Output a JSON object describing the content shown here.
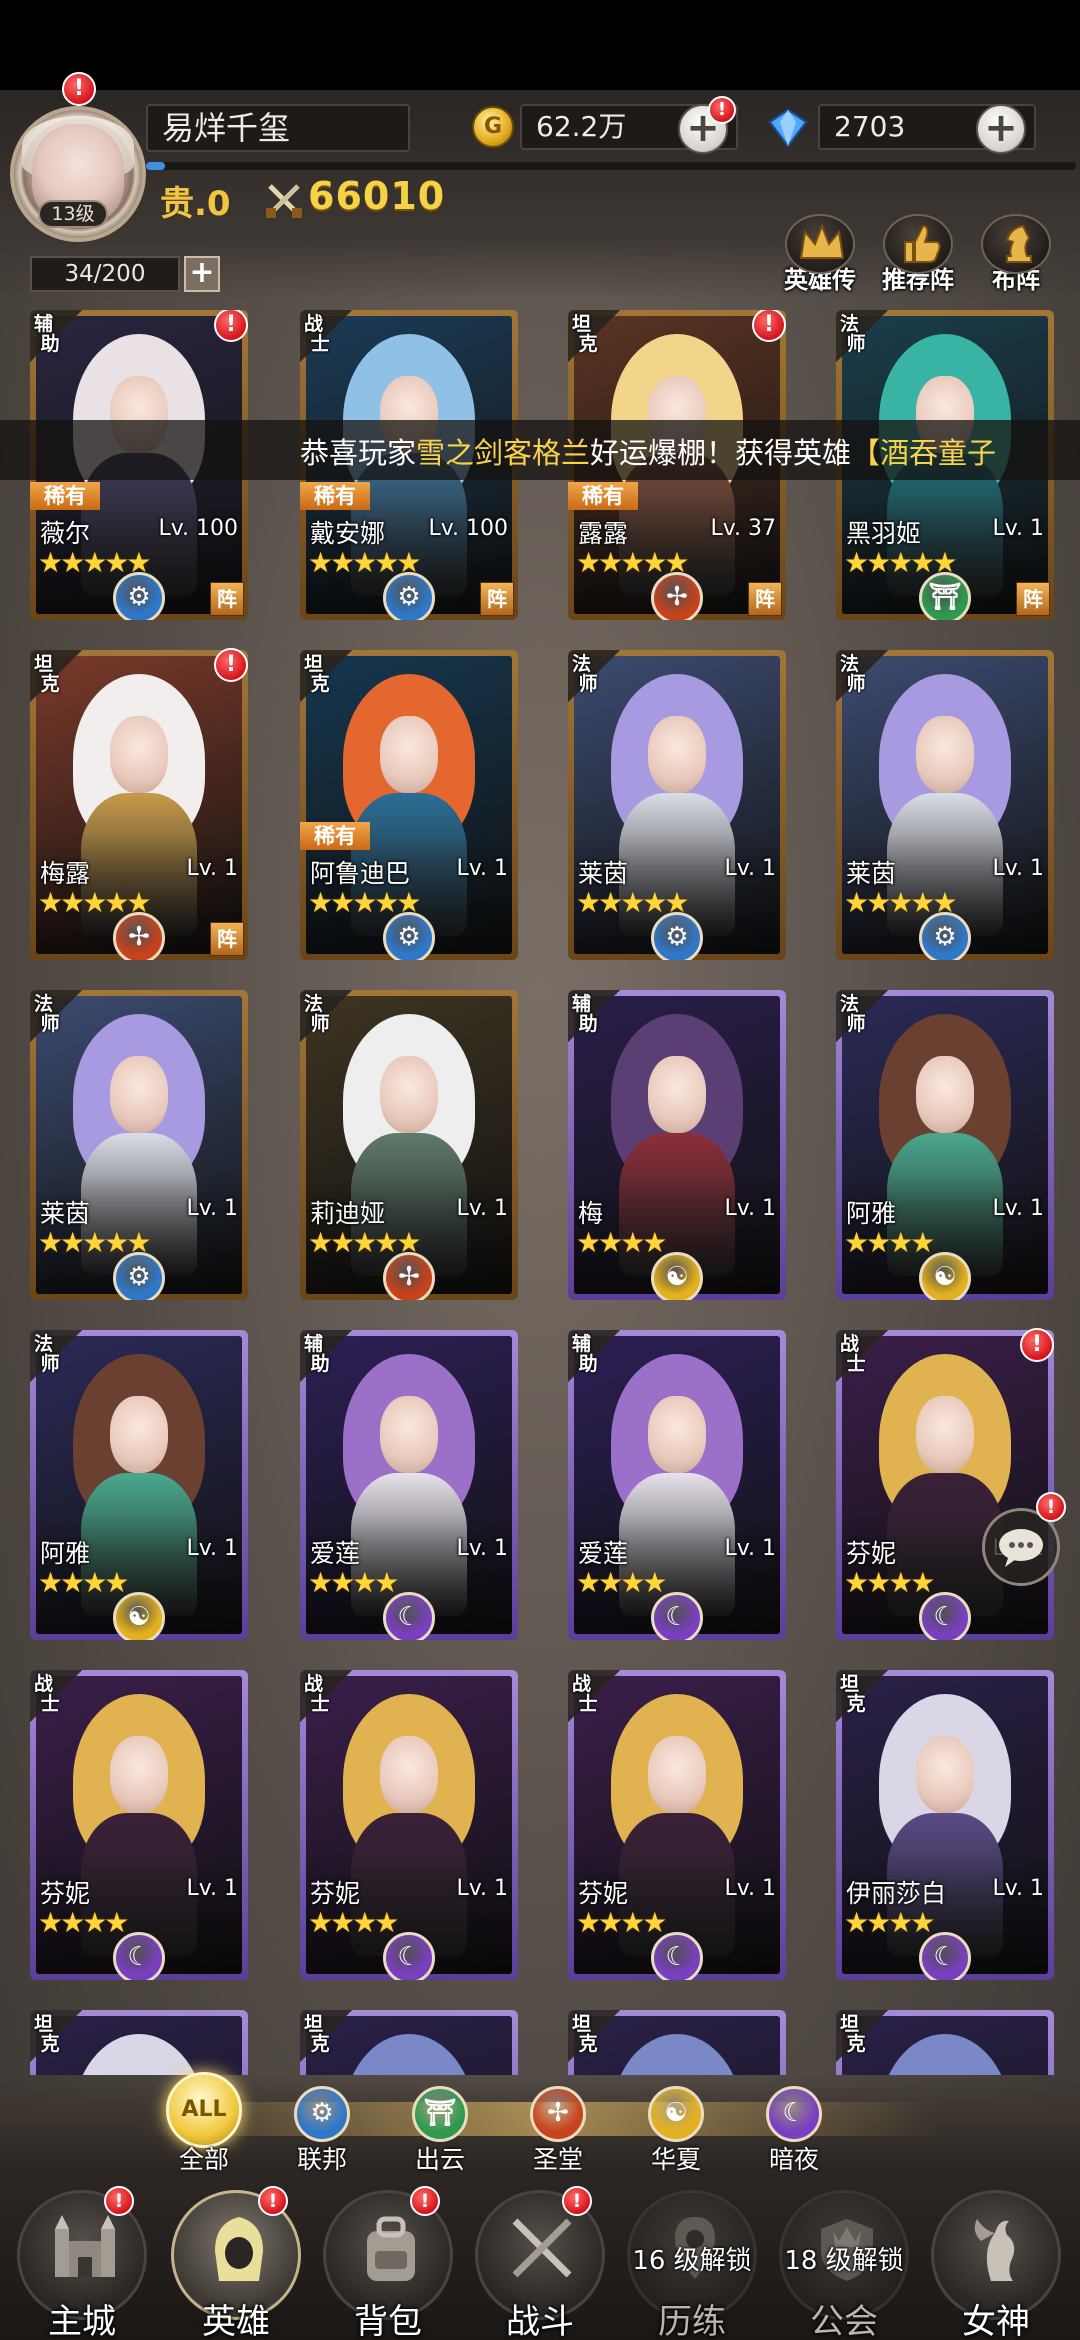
{
  "player": {
    "name": "易烊千玺",
    "level": "13级",
    "vip": "贵.0",
    "power": "66010",
    "gold": "62.2万",
    "gems": "2703",
    "xp_fraction": 0.02
  },
  "roster": {
    "count": "34/200"
  },
  "top_buttons": [
    {
      "label": "英雄传",
      "icon": "crown-icon"
    },
    {
      "label": "推荐阵",
      "icon": "thumbs-up-icon"
    },
    {
      "label": "布阵",
      "icon": "chess-knight-icon"
    }
  ],
  "marquee": {
    "prefix": "恭喜玩家",
    "player": "雪之剑客格兰",
    "middle": "好运爆棚！获得英雄",
    "hero": "【酒吞童子"
  },
  "heroes": [
    {
      "role": "辅助",
      "name": "薇尔",
      "level": "Lv. 100",
      "stars": 5,
      "rare": "稀有",
      "faction": "联邦",
      "formation": "阵",
      "alert": true,
      "frame": "gold",
      "hair": "#e9e1e4",
      "body": "#3c3a58",
      "bg": "#2a2540"
    },
    {
      "role": "战士",
      "name": "戴安娜",
      "level": "Lv. 100",
      "stars": 5,
      "rare": "稀有",
      "faction": "联邦",
      "formation": "阵",
      "alert": false,
      "frame": "gold",
      "hair": "#8fc1e6",
      "body": "#3b6b8f",
      "bg": "#1c3b56"
    },
    {
      "role": "坦克",
      "name": "露露",
      "level": "Lv. 37",
      "stars": 5,
      "rare": "稀有",
      "faction": "圣堂",
      "formation": "阵",
      "alert": true,
      "frame": "gold",
      "hair": "#f2d58a",
      "body": "#7a4b3a",
      "bg": "#5b3423"
    },
    {
      "role": "法师",
      "name": "黑羽姬",
      "level": "Lv. 1",
      "stars": 5,
      "rare": "",
      "faction": "出云",
      "formation": "阵",
      "alert": false,
      "frame": "gold",
      "hair": "#39b3a4",
      "body": "#1f6f7a",
      "bg": "#1b3e4c"
    },
    {
      "role": "坦克",
      "name": "梅露",
      "level": "Lv. 1",
      "stars": 5,
      "rare": "",
      "faction": "圣堂",
      "formation": "阵",
      "alert": true,
      "frame": "gold",
      "hair": "#f2eeee",
      "body": "#c79a4a",
      "bg": "#7a3a2a"
    },
    {
      "role": "坦克",
      "name": "阿鲁迪巴",
      "level": "Lv. 1",
      "stars": 5,
      "rare": "稀有",
      "faction": "联邦",
      "formation": "",
      "alert": false,
      "frame": "gold",
      "hair": "#e4672f",
      "body": "#2b6f97",
      "bg": "#16374f"
    },
    {
      "role": "法师",
      "name": "莱茵",
      "level": "Lv. 1",
      "stars": 5,
      "rare": "",
      "faction": "联邦",
      "formation": "",
      "alert": false,
      "frame": "gold",
      "hair": "#a79ae0",
      "body": "#d9dde6",
      "bg": "#3c4b70"
    },
    {
      "role": "法师",
      "name": "莱茵",
      "level": "Lv. 1",
      "stars": 5,
      "rare": "",
      "faction": "联邦",
      "formation": "",
      "alert": false,
      "frame": "gold",
      "hair": "#a79ae0",
      "body": "#d9dde6",
      "bg": "#3c4b70"
    },
    {
      "role": "法师",
      "name": "莱茵",
      "level": "Lv. 1",
      "stars": 5,
      "rare": "",
      "faction": "联邦",
      "formation": "",
      "alert": false,
      "frame": "gold",
      "hair": "#a79ae0",
      "body": "#d9dde6",
      "bg": "#3c4b70"
    },
    {
      "role": "法师",
      "name": "莉迪娅",
      "level": "Lv. 1",
      "stars": 5,
      "rare": "",
      "faction": "圣堂",
      "formation": "",
      "alert": false,
      "frame": "gold",
      "hair": "#eeeeee",
      "body": "#5f7a6a",
      "bg": "#3e3422"
    },
    {
      "role": "辅助",
      "name": "梅",
      "level": "Lv. 1",
      "stars": 4,
      "rare": "",
      "faction": "华夏",
      "formation": "",
      "alert": false,
      "frame": "purple",
      "hair": "#5b3f74",
      "body": "#8b2e3a",
      "bg": "#2a1e4a"
    },
    {
      "role": "法师",
      "name": "阿雅",
      "level": "Lv. 1",
      "stars": 4,
      "rare": "",
      "faction": "华夏",
      "formation": "",
      "alert": false,
      "frame": "purple",
      "hair": "#6a4030",
      "body": "#4aa88e",
      "bg": "#2b2a58"
    },
    {
      "role": "法师",
      "name": "阿雅",
      "level": "Lv. 1",
      "stars": 4,
      "rare": "",
      "faction": "华夏",
      "formation": "",
      "alert": false,
      "frame": "purple",
      "hair": "#6a4030",
      "body": "#4aa88e",
      "bg": "#2b2a58"
    },
    {
      "role": "辅助",
      "name": "爱莲",
      "level": "Lv. 1",
      "stars": 4,
      "rare": "",
      "faction": "暗夜",
      "formation": "",
      "alert": false,
      "frame": "purple",
      "hair": "#9a70c8",
      "body": "#e8e2ec",
      "bg": "#2c1f55"
    },
    {
      "role": "辅助",
      "name": "爱莲",
      "level": "Lv. 1",
      "stars": 4,
      "rare": "",
      "faction": "暗夜",
      "formation": "",
      "alert": false,
      "frame": "purple",
      "hair": "#9a70c8",
      "body": "#e8e2ec",
      "bg": "#2c1f55"
    },
    {
      "role": "战士",
      "name": "芬妮",
      "level": "Lv. 1",
      "stars": 4,
      "rare": "",
      "faction": "暗夜",
      "formation": "",
      "alert": true,
      "frame": "purple",
      "hair": "#e0b250",
      "body": "#3a2038",
      "bg": "#3a1e4a"
    },
    {
      "role": "战士",
      "name": "芬妮",
      "level": "Lv. 1",
      "stars": 4,
      "rare": "",
      "faction": "暗夜",
      "formation": "",
      "alert": false,
      "frame": "purple",
      "hair": "#e0b250",
      "body": "#3a2038",
      "bg": "#3a1e4a"
    },
    {
      "role": "战士",
      "name": "芬妮",
      "level": "Lv. 1",
      "stars": 4,
      "rare": "",
      "faction": "暗夜",
      "formation": "",
      "alert": false,
      "frame": "purple",
      "hair": "#e0b250",
      "body": "#3a2038",
      "bg": "#3a1e4a"
    },
    {
      "role": "战士",
      "name": "芬妮",
      "level": "Lv. 1",
      "stars": 4,
      "rare": "",
      "faction": "暗夜",
      "formation": "",
      "alert": false,
      "frame": "purple",
      "hair": "#e0b250",
      "body": "#3a2038",
      "bg": "#3a1e4a"
    },
    {
      "role": "坦克",
      "name": "伊丽莎白",
      "level": "Lv. 1",
      "stars": 4,
      "rare": "",
      "faction": "暗夜",
      "formation": "",
      "alert": false,
      "frame": "purple",
      "hair": "#d9d6e6",
      "body": "#5a4a88",
      "bg": "#2a2048"
    },
    {
      "role": "坦克",
      "name": "",
      "level": "",
      "stars": 0,
      "rare": "",
      "faction": "",
      "formation": "",
      "alert": false,
      "frame": "purple",
      "hair": "#d9d6e6",
      "body": "#5a4a88",
      "bg": "#2a2048"
    },
    {
      "role": "坦克",
      "name": "",
      "level": "",
      "stars": 0,
      "rare": "",
      "faction": "",
      "formation": "",
      "alert": false,
      "frame": "purple",
      "hair": "#7a88c8",
      "body": "#5a4a88",
      "bg": "#2a2048"
    },
    {
      "role": "坦克",
      "name": "",
      "level": "",
      "stars": 0,
      "rare": "",
      "faction": "",
      "formation": "",
      "alert": false,
      "frame": "purple",
      "hair": "#7a88c8",
      "body": "#5a4a88",
      "bg": "#2a2048"
    },
    {
      "role": "坦克",
      "name": "",
      "level": "",
      "stars": 0,
      "rare": "",
      "faction": "",
      "formation": "",
      "alert": false,
      "frame": "purple",
      "hair": "#7a88c8",
      "body": "#5a4a88",
      "bg": "#2a2048"
    }
  ],
  "factions": [
    {
      "label": "全部",
      "icon_text": "ALL",
      "active": true,
      "color": "#f1c93d"
    },
    {
      "label": "联邦",
      "icon_text": "⚙",
      "active": false,
      "color": "#2f78c8"
    },
    {
      "label": "出云",
      "icon_text": "⛩",
      "active": false,
      "color": "#2e9a4e"
    },
    {
      "label": "圣堂",
      "icon_text": "✢",
      "active": false,
      "color": "#c8421c"
    },
    {
      "label": "华夏",
      "icon_text": "☯",
      "active": false,
      "color": "#e3b11f"
    },
    {
      "label": "暗夜",
      "icon_text": "☾",
      "active": false,
      "color": "#7a3fc0"
    }
  ],
  "faction_colors": {
    "联邦": "#2f78c8",
    "出云": "#2e9a4e",
    "圣堂": "#c8421c",
    "华夏": "#e3b11f",
    "暗夜": "#7a3fc0"
  },
  "faction_glyphs": {
    "联邦": "⚙",
    "出云": "⛩",
    "圣堂": "✢",
    "华夏": "☯",
    "暗夜": "☾"
  },
  "nav": [
    {
      "label": "主城",
      "alert": true,
      "active": false,
      "locked": false,
      "lock_text": ""
    },
    {
      "label": "英雄",
      "alert": true,
      "active": true,
      "locked": false,
      "lock_text": ""
    },
    {
      "label": "背包",
      "alert": true,
      "active": false,
      "locked": false,
      "lock_text": ""
    },
    {
      "label": "战斗",
      "alert": true,
      "active": false,
      "locked": false,
      "lock_text": ""
    },
    {
      "label": "历练",
      "alert": false,
      "active": false,
      "locked": true,
      "lock_text": "16 级解锁"
    },
    {
      "label": "公会",
      "alert": false,
      "active": false,
      "locked": true,
      "lock_text": "18 级解锁"
    },
    {
      "label": "女神",
      "alert": false,
      "active": false,
      "locked": false,
      "lock_text": ""
    }
  ],
  "colors": {
    "accent_gold": "#f6d247",
    "badge_red": "#d5141b",
    "xp_blue": "#3f8fe0"
  }
}
